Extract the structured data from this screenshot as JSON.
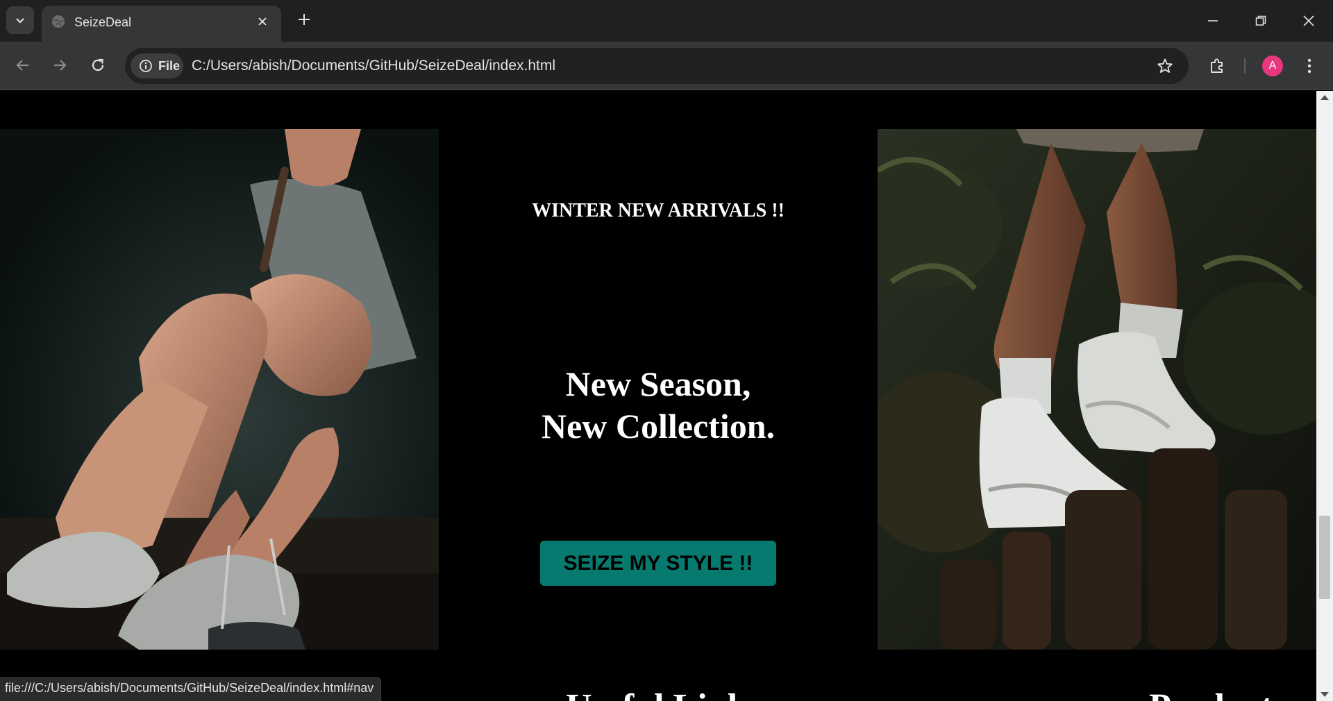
{
  "browser": {
    "tab_title": "SeizeDeal",
    "url": "C:/Users/abish/Documents/GitHub/SeizeDeal/index.html",
    "chip_label": "File",
    "profile_initial": "A",
    "status_url": "file:///C:/Users/abish/Documents/GitHub/SeizeDeal/index.html#nav"
  },
  "hero": {
    "kicker": "WINTER NEW ARRIVALS !!",
    "headline_line1": "New Season,",
    "headline_line2": "New Collection.",
    "cta_label": "SEIZE MY STYLE !!",
    "cta_color": "#077a6f",
    "left_image": "woman-tying-sneakers-photo",
    "right_image": "white-high-top-sneakers-photo"
  },
  "footer_peek": {
    "left_heading": "Useful Links",
    "right_heading": "Products"
  },
  "colors": {
    "page_bg": "#000000",
    "tabbar_bg": "#1f2020",
    "toolbar_bg": "#353637",
    "avatar_bg": "#e8377f"
  }
}
